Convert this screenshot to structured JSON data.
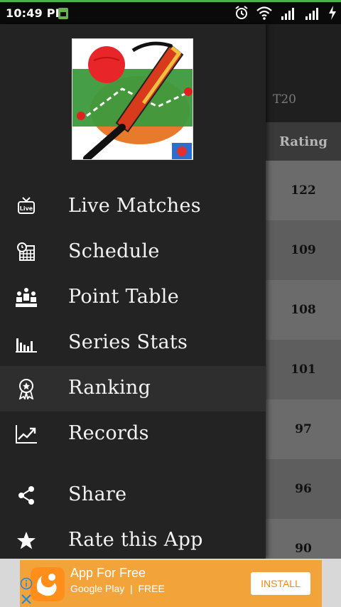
{
  "status_bar": {
    "time": "10:49 PM",
    "icons": [
      "notification-icon",
      "alarm-icon",
      "wifi-icon",
      "signal-icon",
      "signal-icon",
      "charging-icon"
    ]
  },
  "background": {
    "tab_label": "T20",
    "column_header": "Rating",
    "ratings": [
      "122",
      "109",
      "108",
      "101",
      "97",
      "96",
      "90"
    ]
  },
  "drawer": {
    "menu": [
      {
        "label": "Live Matches",
        "icon": "live-tv-icon"
      },
      {
        "label": "Schedule",
        "icon": "calendar-clock-icon"
      },
      {
        "label": "Point Table",
        "icon": "podium-people-icon"
      },
      {
        "label": "Series Stats",
        "icon": "bar-stats-icon"
      },
      {
        "label": "Ranking",
        "icon": "award-badge-icon",
        "active": true
      },
      {
        "label": "Records",
        "icon": "trending-chart-icon"
      }
    ],
    "secondary": [
      {
        "label": "Share",
        "icon": "share-icon"
      },
      {
        "label": "Rate this App",
        "icon": "star-icon"
      }
    ]
  },
  "ad": {
    "title": "App For Free",
    "subtitle_store": "Google Play",
    "subtitle_tag": "FREE",
    "button": "INSTALL"
  },
  "colors": {
    "accent_green": "#4caf50",
    "drawer_bg": "#232323",
    "ad_orange": "#f2a33a"
  }
}
